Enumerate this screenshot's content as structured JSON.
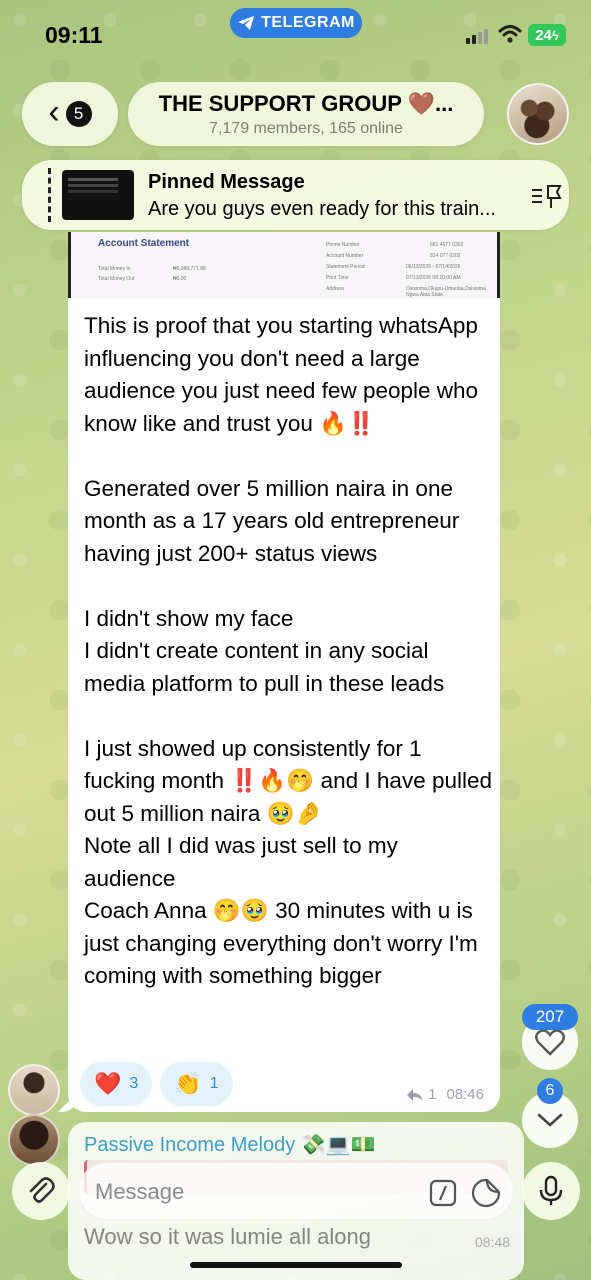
{
  "status_bar": {
    "time": "09:11",
    "app_pill": "TELEGRAM",
    "battery": "24"
  },
  "header": {
    "back_badge": "5",
    "title": "THE SUPPORT GROUP 🤎...",
    "subtitle": "7,179 members, 165 online"
  },
  "pinned": {
    "title": "Pinned Message",
    "text": "Are you guys even ready for this train..."
  },
  "message": {
    "attachment": {
      "title": "Account Statement",
      "total_money_in_label": "Total Money In",
      "total_money_in": "₦5,088,771.88",
      "total_money_out_label": "Total Money Out",
      "total_money_out": "₦0.00",
      "phone_label": "Phone Number",
      "phone": "681 4677 0302",
      "account_label": "Account Number",
      "account": "814 077 0202",
      "period_label": "Statement Period",
      "period": "06/13/2026 - 07/14/2026",
      "print_label": "Print Time",
      "print_time": "07/13/2026 08:20:00 AM",
      "address_label": "Address",
      "address": "Osisioma,Okupu-Umuoba,Osisioma Ngwa Abia State"
    },
    "text": "This is proof that you starting whatsApp influencing you don't need a large audience you just need few people who know like and trust you 🔥‼️\n\nGenerated over 5 million naira in one month as a 17 years old entrepreneur having just 200+ status views\n\nI didn't show my face\nI didn't create content in any social media platform to pull in these leads\n\nI just showed up consistently for 1 fucking month ‼️🔥🤭 and I have pulled out 5 million naira 🥹🤌\nNote all I did was just sell to my audience\nCoach Anna 🤭🥹 30 minutes with u is just changing everything don't worry I'm coming with something bigger",
    "reactions": [
      {
        "emoji": "❤️",
        "count": "3"
      },
      {
        "emoji": "👏",
        "count": "1"
      }
    ],
    "replies": "1",
    "time": "08:46"
  },
  "next_message": {
    "sender": "Passive Income Melody 💸💻💵",
    "text": "Wow so it was lumie all along",
    "time": "08:48"
  },
  "floating": {
    "reactions_count": "207",
    "unread_count": "6"
  },
  "input": {
    "placeholder": "Message"
  },
  "colors": {
    "accent": "#2f7de1",
    "reaction_bg": "#e3f1fb",
    "sender": "#3a9fc4"
  }
}
